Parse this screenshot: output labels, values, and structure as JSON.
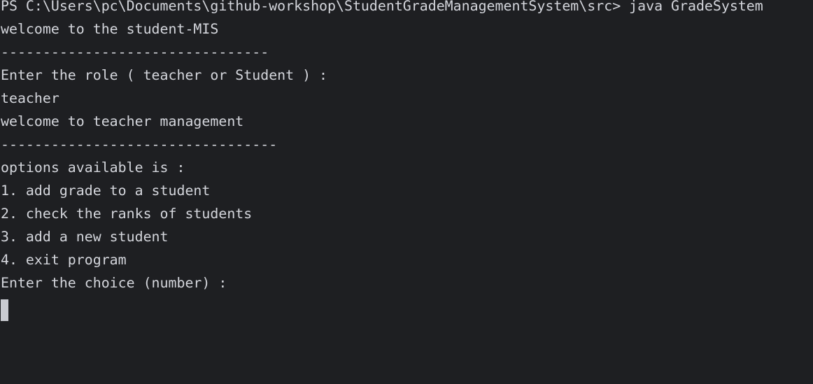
{
  "terminal": {
    "lines": [
      "PS C:\\Users\\pc\\Documents\\github-workshop\\StudentGradeManagementSystem\\src> java GradeSystem",
      "welcome to the student-MIS",
      "--------------------------------",
      "Enter the role ( teacher or Student ) :",
      "teacher",
      "welcome to teacher management",
      "---------------------------------",
      "options available is :",
      "1. add grade to a student",
      "2. check the ranks of students",
      "3. add a new student",
      "4. exit program",
      "Enter the choice (number) :"
    ]
  }
}
